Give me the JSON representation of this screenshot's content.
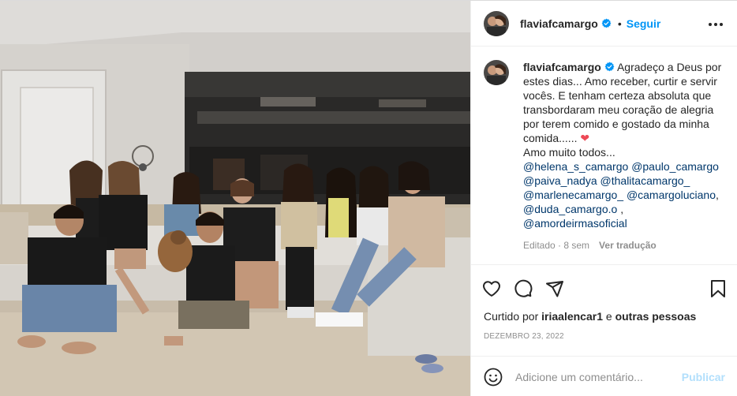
{
  "post": {
    "author": {
      "username": "flaviafcamargo",
      "verified_icon": "verified-badge-icon",
      "follow_label": "Seguir",
      "separator": "•"
    },
    "caption": {
      "text_line": "Agradeço a Deus por estes dias... Amo receber, curtir e servir vocês. E tenham certeza absoluta que transbordaram meu coração de alegria por terem comido e gostado da minha comida......",
      "heart": "❤",
      "closing": "Amo muito todos...",
      "mentions": [
        "@helena_s_camargo",
        "@paulo_camargo",
        "@paiva_nadya",
        "@thalitacamargo_",
        "@marlenecamargo_",
        "@camargoluciano",
        "@duda_camargo.o",
        "@amordeirmasoficial"
      ],
      "comma": ",",
      "edited": "Editado · 8 sem",
      "translate": "Ver tradução"
    },
    "likes": {
      "prefix": "Curtido por ",
      "user": "iriaalencar1",
      "middle": " e ",
      "others": "outras pessoas"
    },
    "date": "DEZEMBRO 23, 2022",
    "comment_box": {
      "placeholder": "Adicione um comentário...",
      "publish_label": "Publicar"
    },
    "icons": {
      "like": "heart-outline-icon",
      "comment": "comment-bubble-icon",
      "share": "paper-plane-icon",
      "save": "bookmark-icon",
      "more": "more-options-icon",
      "emoji": "emoji-smile-icon"
    },
    "colors": {
      "link_blue": "#0095f6",
      "mention": "#00376b",
      "muted": "#8e8e8e",
      "heart": "#ed4956",
      "publish_disabled": "#b2dffc"
    }
  }
}
